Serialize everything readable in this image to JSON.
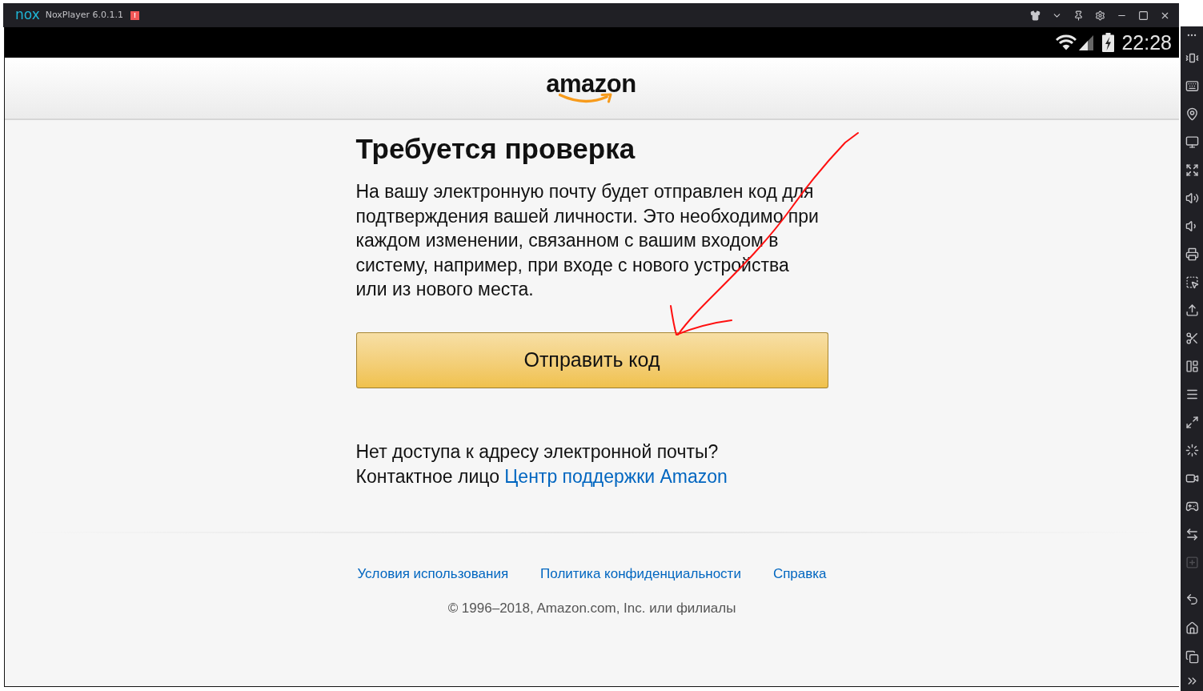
{
  "window": {
    "logo": "nox",
    "title": "NoxPlayer 6.0.1.1",
    "alert_badge": "!"
  },
  "status_bar": {
    "time": "22:28"
  },
  "header": {
    "logo": "amazon"
  },
  "verification": {
    "heading": "Требуется проверка",
    "message": "На вашу электронную почту будет отправлен код для подтверждения вашей личности. Это необходимо при каждом изменении, связанном с вашим входом в систему, например, при входе с нового устройства или из нового места.",
    "button": "Отправить код",
    "no_access": "Нет доступа к адресу электронной почты?",
    "contact_label": "Контактное лицо",
    "contact_link": "Центр поддержки Amazon"
  },
  "footer": {
    "links": [
      "Условия использования",
      "Политика конфиденциальности",
      "Справка"
    ],
    "copyright": "© 1996–2018, Amazon.com, Inc. или филиалы"
  },
  "side_toolbar": [
    {
      "disabled": false
    },
    {
      "disabled": false
    },
    {
      "disabled": false
    },
    {
      "disabled": false
    },
    {
      "disabled": false
    },
    {
      "disabled": false
    },
    {
      "disabled": false
    },
    {
      "disabled": false
    },
    {
      "disabled": false
    },
    {
      "disabled": false
    },
    {
      "disabled": false
    },
    {
      "disabled": false
    },
    {
      "disabled": false
    },
    {
      "disabled": false
    },
    {
      "disabled": false
    },
    {
      "disabled": false
    },
    {
      "disabled": false
    },
    {
      "disabled": false
    },
    {
      "disabled": false
    },
    {
      "disabled": true
    },
    {
      "disabled": false
    },
    {
      "disabled": false
    },
    {
      "disabled": false
    },
    {
      "disabled": false
    }
  ]
}
